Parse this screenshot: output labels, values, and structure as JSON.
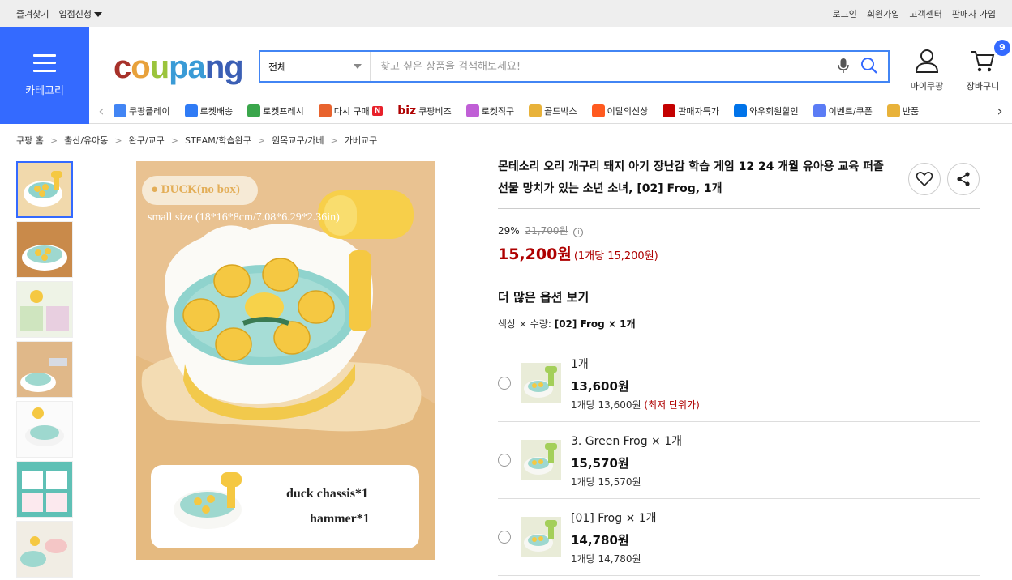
{
  "topbar": {
    "favorites": "즐겨찾기",
    "seller_apply": "입점신청",
    "login": "로그인",
    "signup": "회원가입",
    "customer_center": "고객센터",
    "seller_signup": "판매자 가입"
  },
  "header": {
    "category_label": "카테고리",
    "logo": {
      "c": "c",
      "o": "o",
      "u": "u",
      "pa": "pa",
      "ng": "ng"
    },
    "search": {
      "category": "전체",
      "placeholder": "찾고 싶은 상품을 검색해보세요!"
    },
    "mypage": "마이쿠팡",
    "cart": "장바구니",
    "cart_count": "9"
  },
  "nav": {
    "items": [
      {
        "label": "쿠팡플레이",
        "color": "#4285f4"
      },
      {
        "label": "로켓배송",
        "color": "#2f7bf5"
      },
      {
        "label": "로켓프레시",
        "color": "#3aa64b"
      },
      {
        "label": "다시 구매",
        "color": "#e8632e",
        "badge": "N"
      },
      {
        "label": "쿠팡비즈",
        "prefix": "biz",
        "color": "#ae0000"
      },
      {
        "label": "로켓직구",
        "color": "#c05fd6"
      },
      {
        "label": "골드박스",
        "color": "#e8b23a"
      },
      {
        "label": "이달의신상",
        "color": "#ff5a1f"
      },
      {
        "label": "판매자특가",
        "color": "#c40000"
      },
      {
        "label": "와우회원할인",
        "color": "#0073e9"
      },
      {
        "label": "이벤트/쿠폰",
        "color": "#5b7cf5"
      },
      {
        "label": "반품",
        "color": "#e8b23a"
      }
    ]
  },
  "breadcrumb": [
    "쿠팡 홈",
    "출산/유아동",
    "완구/교구",
    "STEAM/학습완구",
    "원목교구/가베",
    "가베교구"
  ],
  "product": {
    "title": "몬테소리 오리 개구리 돼지 아기 장난감 학습 게임 12 24 개월 유아용 교육 퍼즐 선물 망치가 있는 소년 소녀, [02] Frog, 1개",
    "discount_rate": "29%",
    "original_price": "21,700원",
    "price": "15,200원",
    "unit_price": "(1개당 15,200원)",
    "more_options_heading": "더 많은 옵션 보기",
    "color_qty_label": "색상 × 수량:",
    "color_qty_value": "[02] Frog × 1개",
    "image_text": {
      "badge": "● DUCK(no box)",
      "size": "small size (18*16*8cm/7.08*6.29*2.36in)",
      "chassis": "duck chassis*1",
      "hammer": "hammer*1"
    }
  },
  "options": [
    {
      "name": "1개",
      "price": "13,600원",
      "per": "1개당 13,600원",
      "lowest": "(최저 단위가)"
    },
    {
      "name": "3. Green Frog × 1개",
      "price": "15,570원",
      "per": "1개당 15,570원",
      "lowest": ""
    },
    {
      "name": "[01] Frog × 1개",
      "price": "14,780원",
      "per": "1개당 14,780원",
      "lowest": ""
    }
  ]
}
